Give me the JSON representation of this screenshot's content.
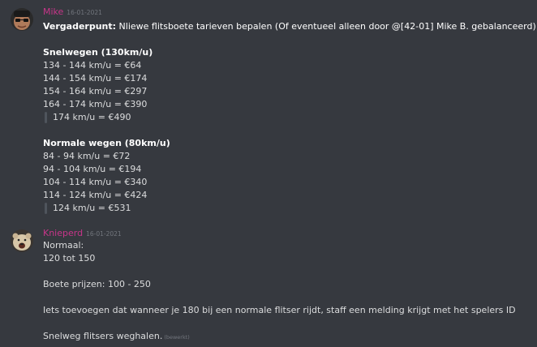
{
  "messages": [
    {
      "author": "Mike",
      "timestamp": "16-01-2021",
      "avatar_icon": "mike-avatar-icon",
      "agenda_label": "Vergaderpunt:",
      "agenda_text": " Nliewe flitsboete tarieven bepalen (Of eventueel alleen door @[42-01] Mike B. gebalanceerd)",
      "highway_heading": "Snelwegen (130km/u)",
      "highway_lines": [
        "134 - 144 km/u = €64",
        "144 - 154 km/u = €174",
        "154 - 164 km/u = €297",
        "164 - 174 km/u = €390"
      ],
      "highway_quote": "174 km/u = €490",
      "normal_heading": "Normale wegen (80km/u)",
      "normal_lines": [
        "84 - 94 km/u = €72",
        "94 - 104 km/u = €194",
        "104 - 114 km/u = €340",
        "114 - 124 km/u = €424"
      ],
      "normal_quote": "124 km/u = €531"
    },
    {
      "author": "Knieperd",
      "timestamp": "16-01-2021",
      "avatar_icon": "knieperd-avatar-icon",
      "lines": [
        "Normaal:",
        "120 tot 150",
        "",
        "Boete prijzen: 100 - 250",
        "",
        "Iets toevoegen dat wanneer je 180 bij een normale flitser rijdt, staff een melding krijgt met het spelers ID",
        "",
        "Snelweg flitsers weghalen."
      ],
      "edited_label": "(bewerkt)"
    }
  ],
  "colors": {
    "background": "#36393f",
    "username": "#c73589",
    "text": "#dcddde",
    "muted": "#72767d",
    "quote_bar": "#4f545c"
  }
}
